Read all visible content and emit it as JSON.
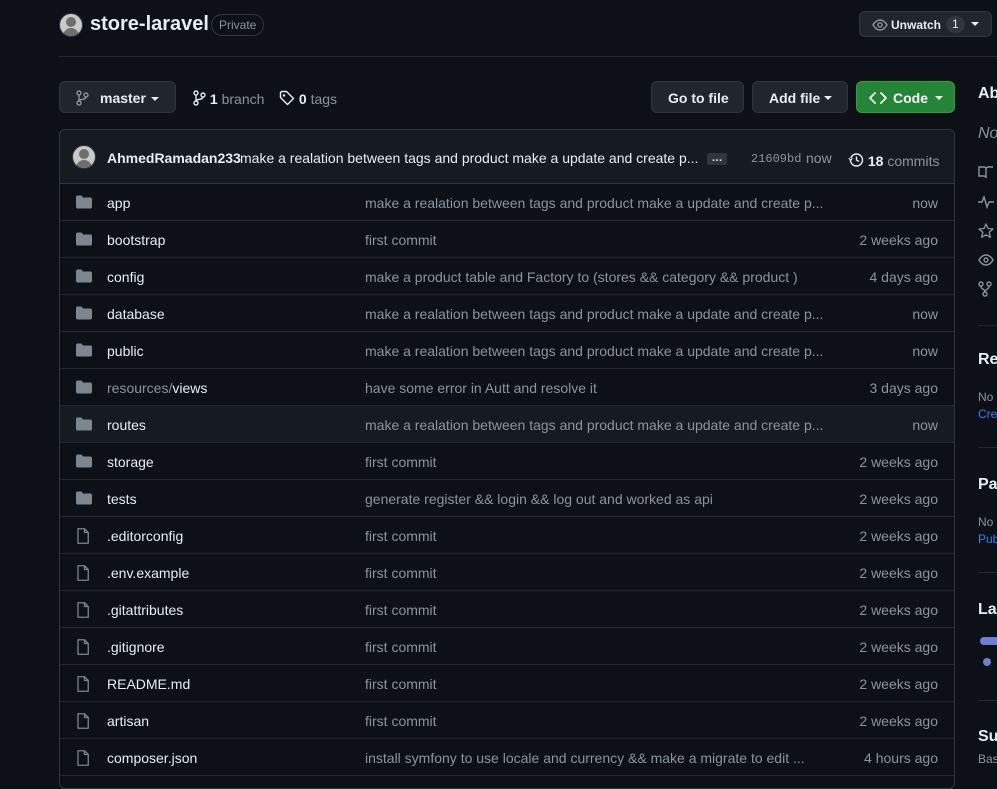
{
  "repo": {
    "name": "store-laravel",
    "visibility": "Private",
    "watch_label": "Unwatch",
    "watch_count": "1"
  },
  "toolbar": {
    "branch": "master",
    "branch_count": "1",
    "branch_word": "branch",
    "tag_count": "0",
    "tag_word": "tags",
    "go_to_file": "Go to file",
    "add_file": "Add file",
    "code": "Code",
    "code_color": "#238636"
  },
  "latest_commit": {
    "author": "AhmedRamadan233",
    "message": "make a realation between tags and product make a update and create p...",
    "ellipsis": "…",
    "hash": "21609bd",
    "time": "now",
    "count": "18",
    "count_word": "commits"
  },
  "files": [
    {
      "name": "app",
      "type": "dir",
      "message": "make a realation between tags and product make a update and create p...",
      "age": "now"
    },
    {
      "name": "bootstrap",
      "type": "dir",
      "message": "first commit",
      "age": "2 weeks ago"
    },
    {
      "name": "config",
      "type": "dir",
      "message": "make a product table and Factory to (stores && category && product )",
      "age": "4 days ago"
    },
    {
      "name": "database",
      "type": "dir",
      "message": "make a realation between tags and product make a update and create p...",
      "age": "now"
    },
    {
      "name": "public",
      "type": "dir",
      "message": "make a realation between tags and product make a update and create p...",
      "age": "now"
    },
    {
      "name_prefix": "resources/",
      "name": "views",
      "type": "dir",
      "message": "have some error in Autt and resolve it",
      "age": "3 days ago"
    },
    {
      "name": "routes",
      "type": "dir",
      "message": "make a realation between tags and product make a update and create p...",
      "age": "now"
    },
    {
      "name": "storage",
      "type": "dir",
      "message": "first commit",
      "age": "2 weeks ago"
    },
    {
      "name": "tests",
      "type": "dir",
      "message": "generate register && login && log out and worked as api",
      "age": "2 weeks ago"
    },
    {
      "name": ".editorconfig",
      "type": "file",
      "message": "first commit",
      "age": "2 weeks ago"
    },
    {
      "name": ".env.example",
      "type": "file",
      "message": "first commit",
      "age": "2 weeks ago"
    },
    {
      "name": ".gitattributes",
      "type": "file",
      "message": "first commit",
      "age": "2 weeks ago"
    },
    {
      "name": ".gitignore",
      "type": "file",
      "message": "first commit",
      "age": "2 weeks ago"
    },
    {
      "name": "README.md",
      "type": "file",
      "message": "first commit",
      "age": "2 weeks ago"
    },
    {
      "name": "artisan",
      "type": "file",
      "message": "first commit",
      "age": "2 weeks ago"
    },
    {
      "name": "composer.json",
      "type": "file",
      "message": "install symfony to use locale and currency && make a migrate to edit ...",
      "age": "4 hours ago"
    }
  ],
  "sidebar": {
    "about_heading": "Ab",
    "about_desc": "No",
    "releases_heading": "Rel",
    "releases_text": "No",
    "releases_link": "Crea",
    "packages_heading": "Pac",
    "packages_text": "No",
    "packages_link": "Pub",
    "languages_heading": "Lan",
    "suggested_heading": "Sug",
    "suggested_text": "Bas"
  }
}
